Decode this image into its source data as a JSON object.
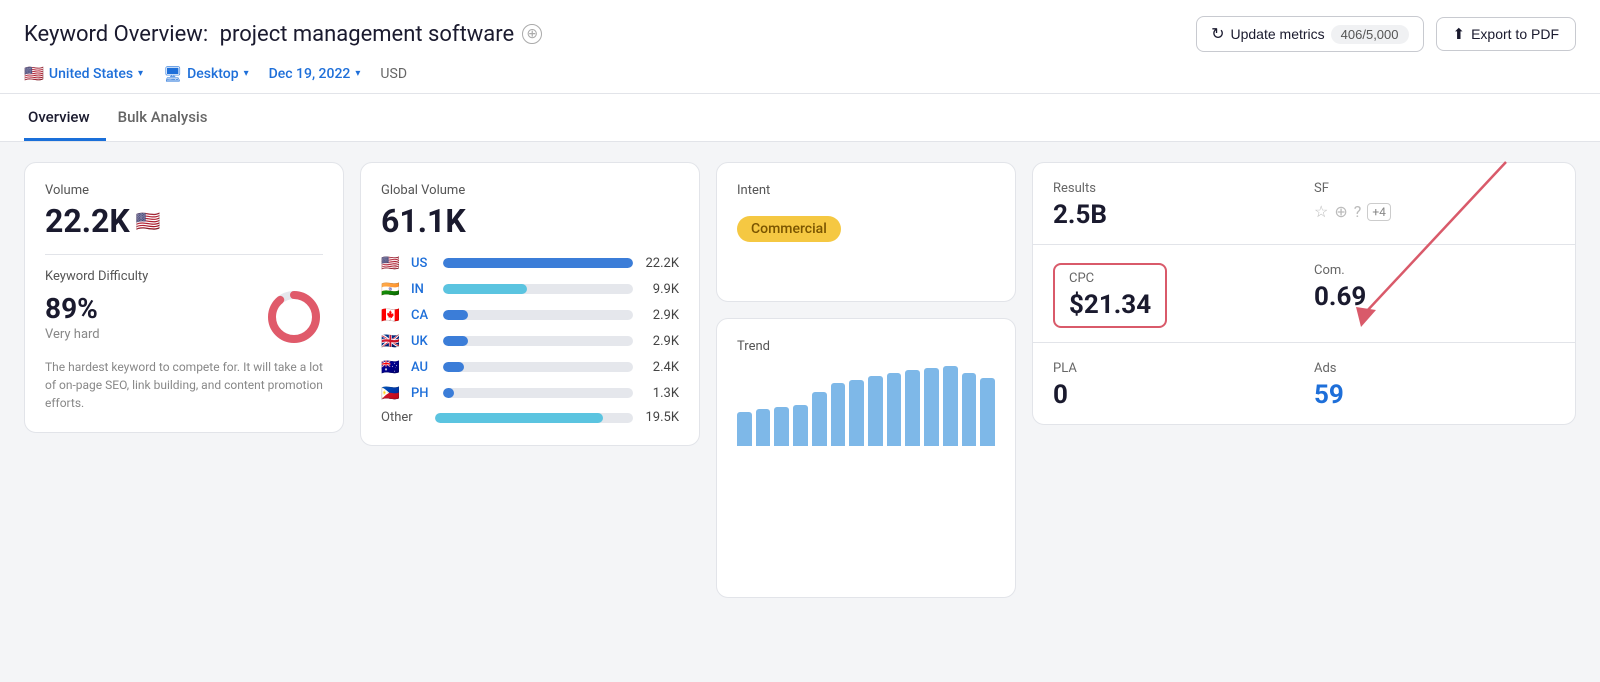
{
  "header": {
    "title_prefix": "Keyword Overview:",
    "keyword": "project management software",
    "add_button_label": "+",
    "update_metrics_label": "Update metrics",
    "update_count": "406/5,000",
    "export_label": "Export to PDF",
    "filters": {
      "country": "United States",
      "country_flag": "🇺🇸",
      "device": "Desktop",
      "date": "Dec 19, 2022",
      "currency": "USD"
    }
  },
  "tabs": [
    {
      "label": "Overview",
      "active": true
    },
    {
      "label": "Bulk Analysis",
      "active": false
    }
  ],
  "volume_card": {
    "label": "Volume",
    "value": "22.2K",
    "flag": "🇺🇸",
    "kd_label": "Keyword Difficulty",
    "kd_value": "89%",
    "kd_sub": "Very hard",
    "kd_donut_percent": 89,
    "description": "The hardest keyword to compete for. It will take a lot of on-page SEO, link building, and content promotion efforts."
  },
  "global_volume_card": {
    "label": "Global Volume",
    "value": "61.1K",
    "countries": [
      {
        "flag": "🇺🇸",
        "code": "US",
        "value": "22.2K",
        "bar_pct": 100,
        "color": "#3b7dd8"
      },
      {
        "flag": "🇮🇳",
        "code": "IN",
        "value": "9.9K",
        "bar_pct": 44,
        "color": "#5bc4e0"
      },
      {
        "flag": "🇨🇦",
        "code": "CA",
        "value": "2.9K",
        "bar_pct": 13,
        "color": "#3b7dd8"
      },
      {
        "flag": "🇬🇧",
        "code": "UK",
        "value": "2.9K",
        "bar_pct": 13,
        "color": "#3b7dd8"
      },
      {
        "flag": "🇦🇺",
        "code": "AU",
        "value": "2.4K",
        "bar_pct": 11,
        "color": "#3b7dd8"
      },
      {
        "flag": "🇵🇭",
        "code": "PH",
        "value": "1.3K",
        "bar_pct": 6,
        "color": "#3b7dd8"
      }
    ],
    "other_label": "Other",
    "other_value": "19.5K",
    "other_bar_pct": 85,
    "other_color": "#5bc4e0"
  },
  "intent_card": {
    "label": "Intent",
    "badge_text": "Commercial",
    "badge_bg": "#f5c842",
    "badge_color": "#7a5500"
  },
  "trend_card": {
    "label": "Trend",
    "bars": [
      35,
      38,
      40,
      42,
      55,
      65,
      68,
      72,
      75,
      78,
      80,
      82,
      75,
      70
    ],
    "bar_color": "#7eb8e8"
  },
  "results_card": {
    "results_label": "Results",
    "results_value": "2.5B",
    "sf_label": "SF",
    "sf_icons": [
      "☆",
      "⊕",
      "?"
    ],
    "sf_plus": "+4"
  },
  "cpc_card": {
    "label": "CPC",
    "value": "$21.34",
    "highlighted": true
  },
  "com_card": {
    "label": "Com.",
    "value": "0.69"
  },
  "pla_card": {
    "label": "PLA",
    "value": "0",
    "value_color": "dark"
  },
  "ads_card": {
    "label": "Ads",
    "value": "59",
    "value_color": "blue"
  }
}
